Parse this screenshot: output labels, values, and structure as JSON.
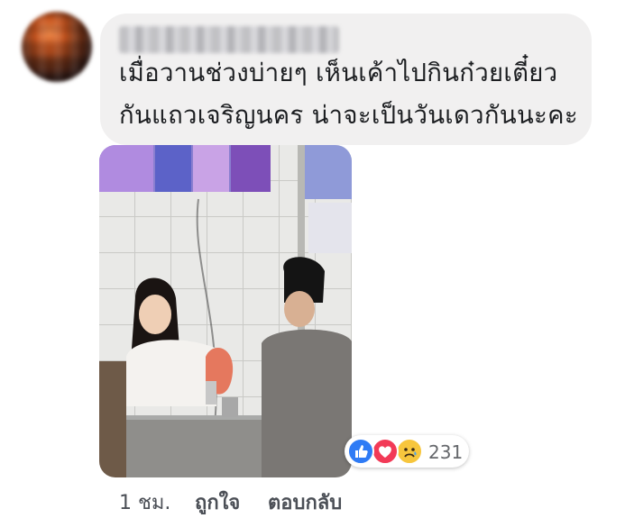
{
  "comment": {
    "author": "",
    "text_lines": [
      "เมื่อวานช่วงบ่ายๆ เห็นเค้าไปกินก๋วยเตี๋ยว",
      "กันแถวเจริญนคร น่าจะเป็นวันเดวกันนะคะ"
    ]
  },
  "reactions": {
    "types": [
      "like-icon",
      "love-icon",
      "sad-icon"
    ],
    "count": "231",
    "colors": {
      "like": "#2f7bf5",
      "love": "#f23a57",
      "sad": "#f7c63d"
    }
  },
  "actions": {
    "time": "1 ชม.",
    "like": "ถูกใจ",
    "reply": "ตอบกลับ"
  }
}
